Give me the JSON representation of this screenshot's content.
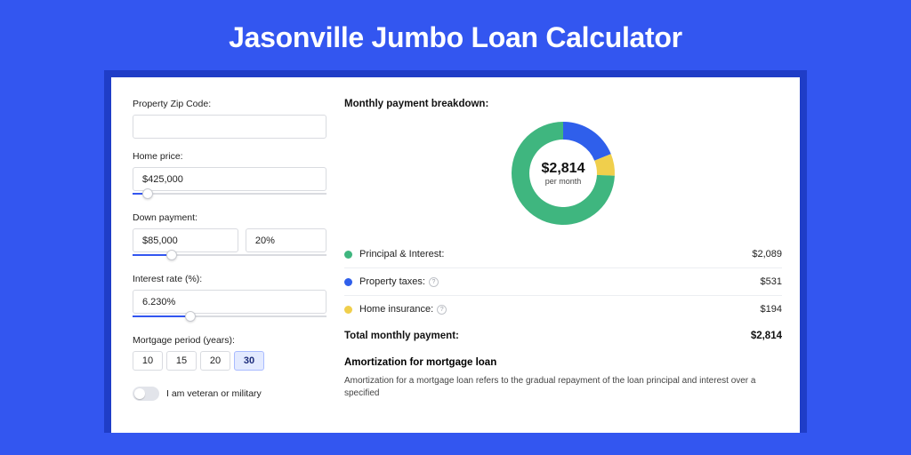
{
  "title": "Jasonville Jumbo Loan Calculator",
  "form": {
    "zip_label": "Property Zip Code:",
    "zip_value": "",
    "price_label": "Home price:",
    "price_value": "$425,000",
    "price_slider_pct": 8,
    "down_label": "Down payment:",
    "down_value": "$85,000",
    "down_pct_value": "20%",
    "down_slider_pct": 20,
    "rate_label": "Interest rate (%):",
    "rate_value": "6.230%",
    "rate_slider_pct": 30,
    "period_label": "Mortgage period (years):",
    "periods": [
      "10",
      "15",
      "20",
      "30"
    ],
    "period_active": 3,
    "veteran_label": "I am veteran or military"
  },
  "breakdown": {
    "title": "Monthly payment breakdown:",
    "donut_value": "$2,814",
    "donut_sub": "per month",
    "items": [
      {
        "label": "Principal & Interest:",
        "value": "$2,089",
        "color": "g",
        "info": false,
        "num": 2089
      },
      {
        "label": "Property taxes:",
        "value": "$531",
        "color": "b",
        "info": true,
        "num": 531
      },
      {
        "label": "Home insurance:",
        "value": "$194",
        "color": "y",
        "info": true,
        "num": 194
      }
    ],
    "total_label": "Total monthly payment:",
    "total_value": "$2,814"
  },
  "amort": {
    "title": "Amortization for mortgage loan",
    "body": "Amortization for a mortgage loan refers to the gradual repayment of the loan principal and interest over a specified"
  },
  "chart_data": {
    "type": "pie",
    "title": "Monthly payment breakdown",
    "series": [
      {
        "name": "Principal & Interest",
        "value": 2089,
        "color": "#3fb67f"
      },
      {
        "name": "Property taxes",
        "value": 531,
        "color": "#2f5feb"
      },
      {
        "name": "Home insurance",
        "value": 194,
        "color": "#f0cf4c"
      }
    ],
    "total": 2814
  }
}
